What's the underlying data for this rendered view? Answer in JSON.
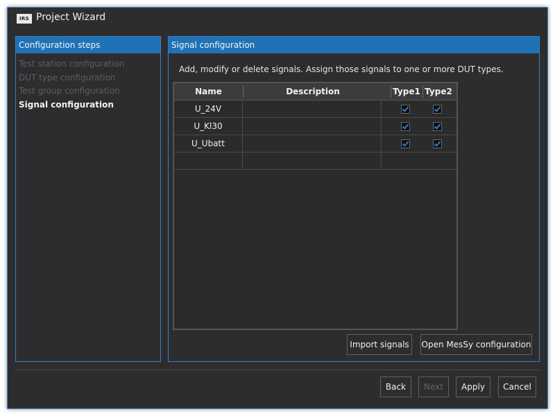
{
  "window": {
    "title": "Project Wizard",
    "logo_text": "IRS"
  },
  "steps_panel": {
    "title": "Configuration steps",
    "items": [
      {
        "label": "Test station configuration",
        "active": false
      },
      {
        "label": "DUT type configuration",
        "active": false
      },
      {
        "label": "Test group configuration",
        "active": false
      },
      {
        "label": "Signal configuration",
        "active": true
      }
    ]
  },
  "signal_panel": {
    "title": "Signal configuration",
    "intro": "Add, modify or delete signals. Assign those signals to one or more DUT types.",
    "table": {
      "columns": [
        "Name",
        "Description",
        "Type1",
        "Type2"
      ],
      "rows": [
        {
          "name": "U_24V",
          "description": "",
          "type1": true,
          "type2": true
        },
        {
          "name": "U_Kl30",
          "description": "",
          "type1": true,
          "type2": true
        },
        {
          "name": "U_Ubatt",
          "description": "",
          "type1": true,
          "type2": true
        },
        {
          "name": "",
          "description": "",
          "type1": null,
          "type2": null
        }
      ]
    },
    "import_button": "Import signals",
    "mesy_button": "Open MesSy configuration"
  },
  "footer": {
    "back": "Back",
    "next": "Next",
    "apply": "Apply",
    "cancel": "Cancel"
  },
  "colors": {
    "accent": "#1f72b5",
    "background": "#2d2d30",
    "checkmark": "#2f8ae0"
  },
  "icons": {
    "checkbox": "checkmark-icon"
  }
}
